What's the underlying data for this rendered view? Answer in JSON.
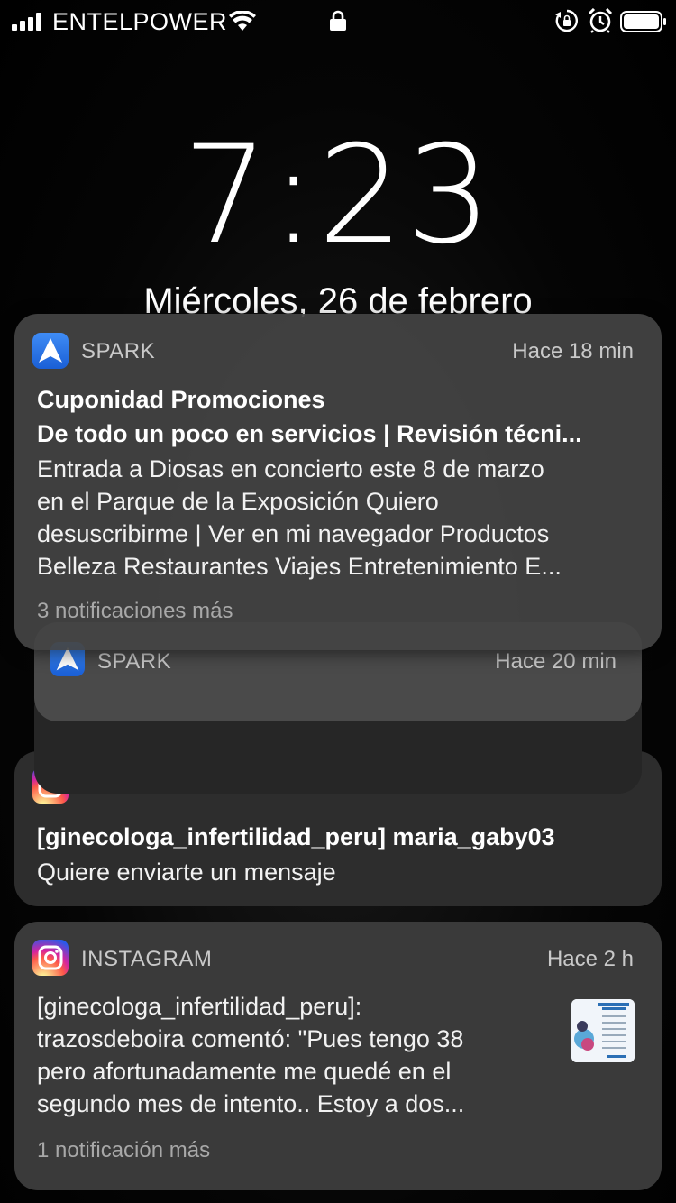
{
  "status_bar": {
    "carrier": "ENTELPOWER"
  },
  "lock_screen": {
    "time": "7:23",
    "date": "Miércoles, 26 de febrero"
  },
  "notifications": [
    {
      "app": "SPARK",
      "time_ago": "Hace 18 min",
      "title": "Cuponidad Promociones",
      "subtitle": "De todo un poco en servicios | Revisión técni...",
      "body_lines": [
        "Entrada a Diosas en concierto este 8 de marzo",
        "en el Parque de la Exposición Quiero",
        "desuscribirme | Ver en mi navegador Productos",
        "Belleza Restaurantes Viajes Entretenimiento E..."
      ],
      "more": "3 notificaciones más",
      "icon": "spark-icon"
    },
    {
      "app": "SPARK",
      "time_ago": "Hace 20 min",
      "icon": "spark-icon"
    },
    {
      "app": "INSTAGRAM",
      "title": "[ginecologa_infertilidad_peru] maria_gaby03",
      "body": "Quiere enviarte un mensaje",
      "icon": "instagram-icon"
    },
    {
      "app": "INSTAGRAM",
      "time_ago": "Hace 2 h",
      "body_lines": [
        "[ginecologa_infertilidad_peru]:",
        "trazosdeboira comentó: \"Pues tengo 38",
        "pero afortunadamente me quedé en el",
        "segundo mes de intento.. Estoy a dos..."
      ],
      "more": "1 notificación más",
      "icon": "instagram-icon"
    }
  ],
  "colors": {
    "spark_blue": "#2f7bef",
    "card_bg": "#444444",
    "secondary_text": "#c9c9c9"
  }
}
